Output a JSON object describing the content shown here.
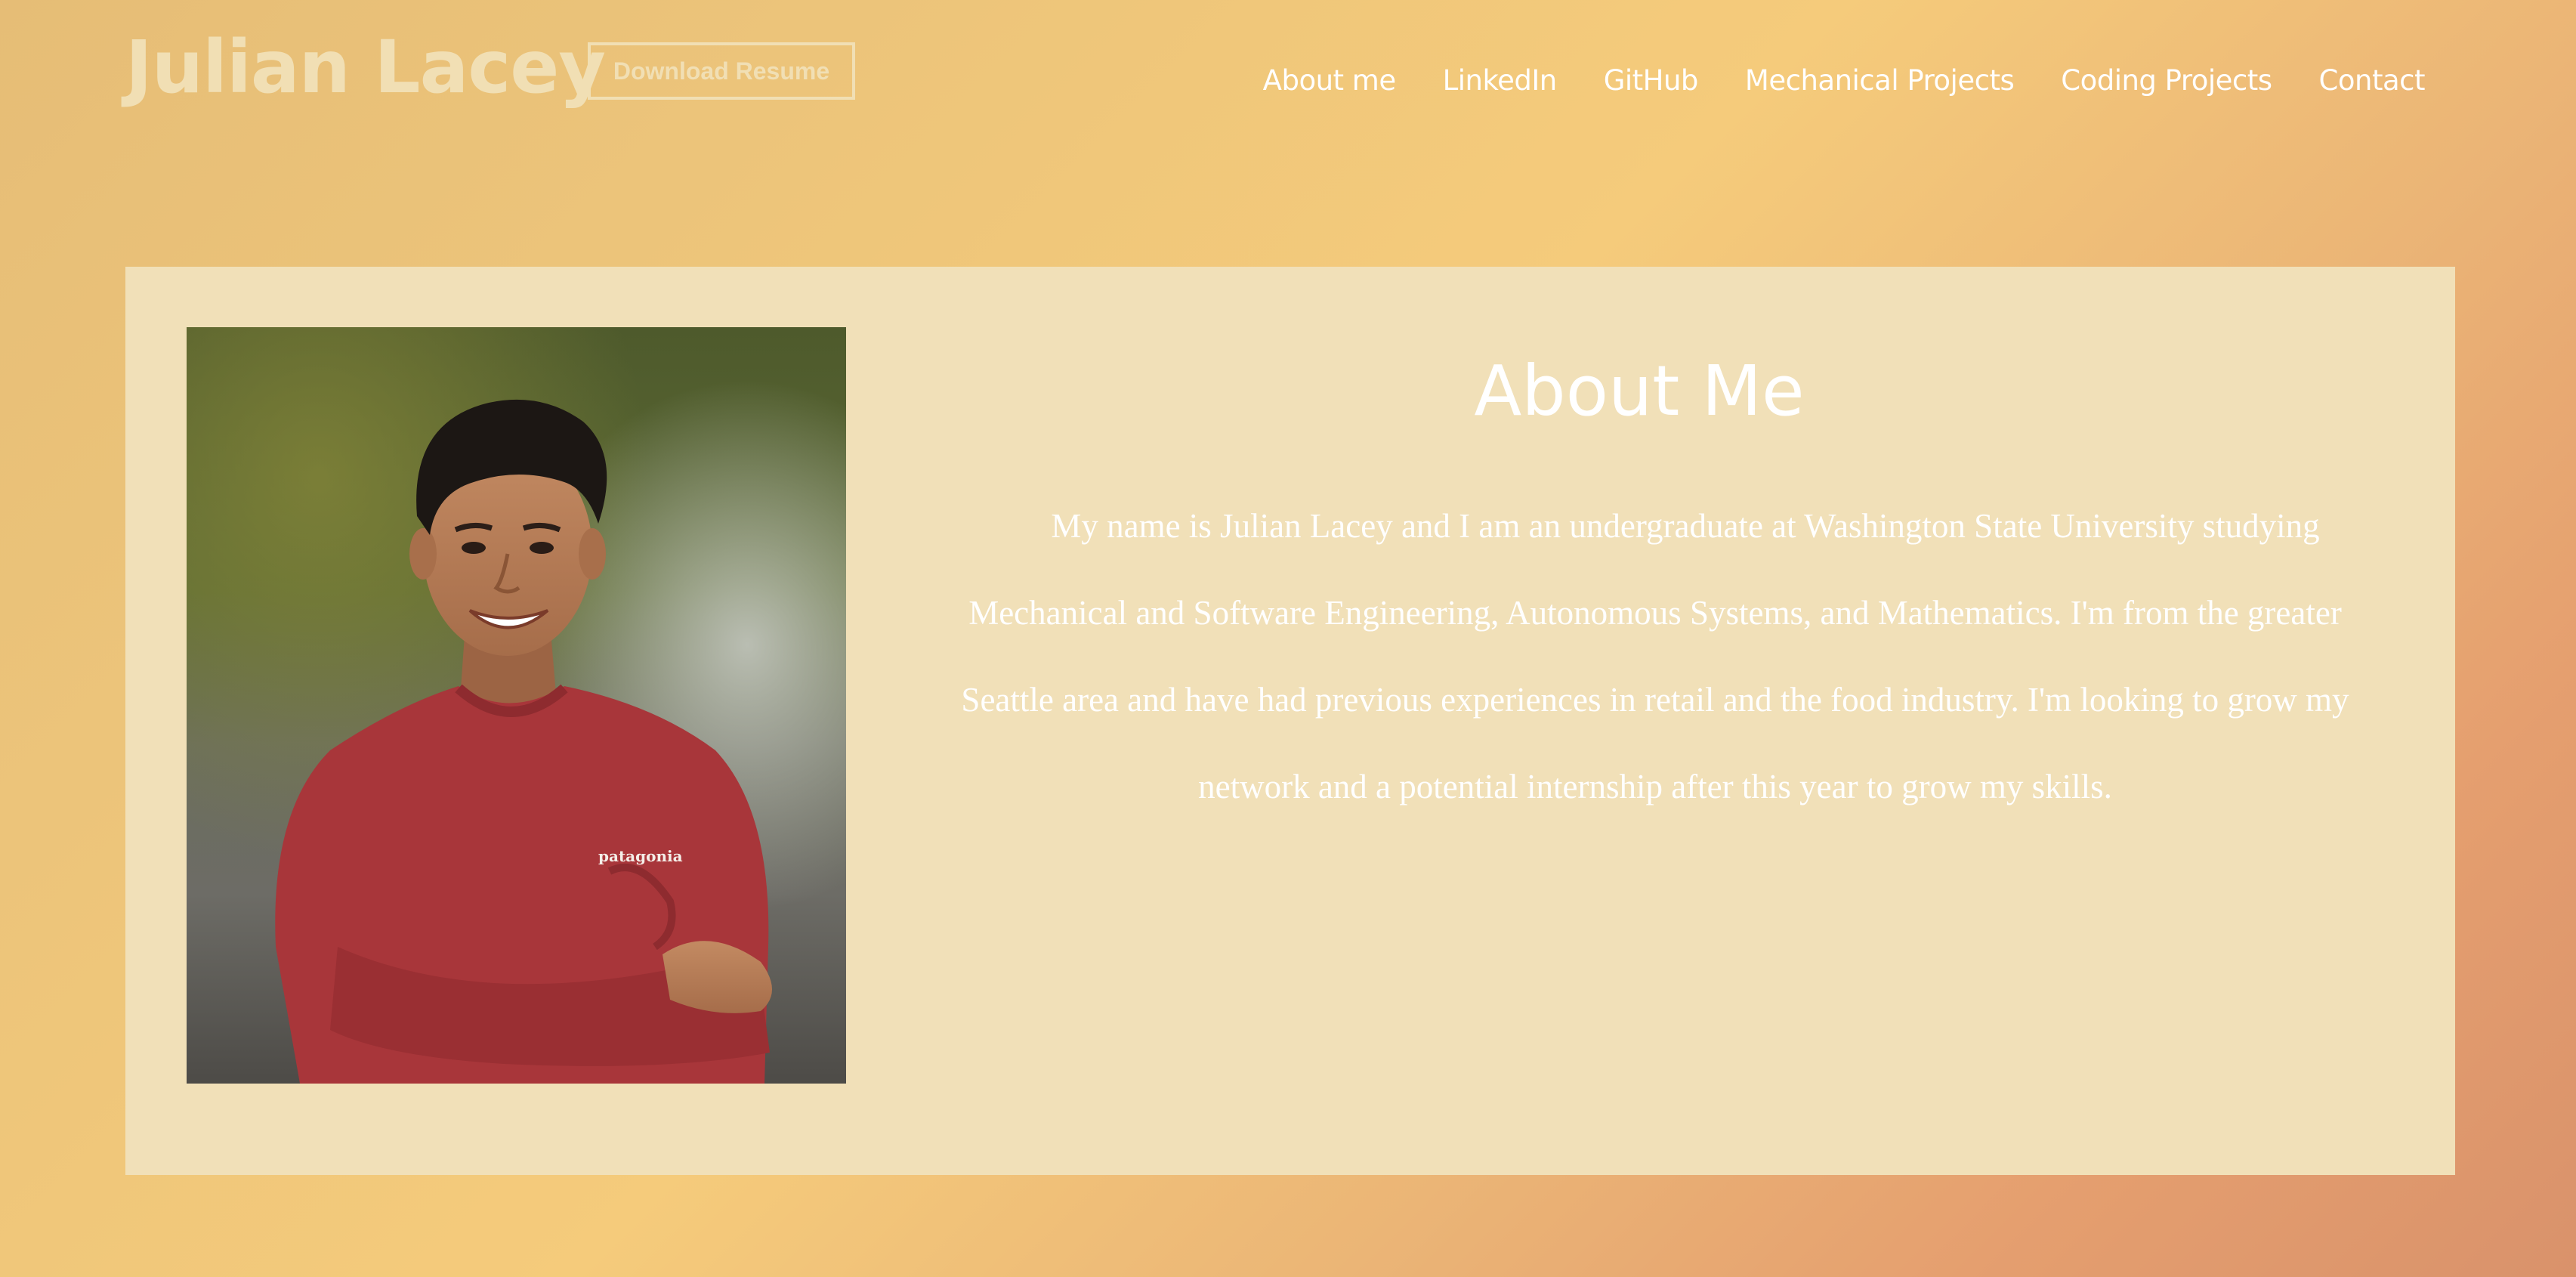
{
  "header": {
    "title": "Julian Lacey",
    "resume_button": "Download Resume"
  },
  "nav": {
    "items": [
      {
        "label": "About me"
      },
      {
        "label": "LinkedIn"
      },
      {
        "label": "GitHub"
      },
      {
        "label": "Mechanical Projects"
      },
      {
        "label": "Coding Projects"
      },
      {
        "label": "Contact"
      }
    ]
  },
  "about": {
    "heading": "About Me",
    "body": "My name is Julian Lacey and I am an undergraduate at Washington State University studying Mechanical and Software Engineering, Autonomous Systems, and Mathematics. I'm from the greater Seattle area and have had previous experiences in retail and the food industry. I'm looking to grow my network and a potential internship after this year to grow my skills.",
    "photo": {
      "shirt_logo": "patagonia"
    }
  },
  "colors": {
    "title": "#f1dfb4",
    "card_background": "#f1e0b8",
    "nav_text": "#ffffff",
    "shirt": "#a8363a"
  }
}
